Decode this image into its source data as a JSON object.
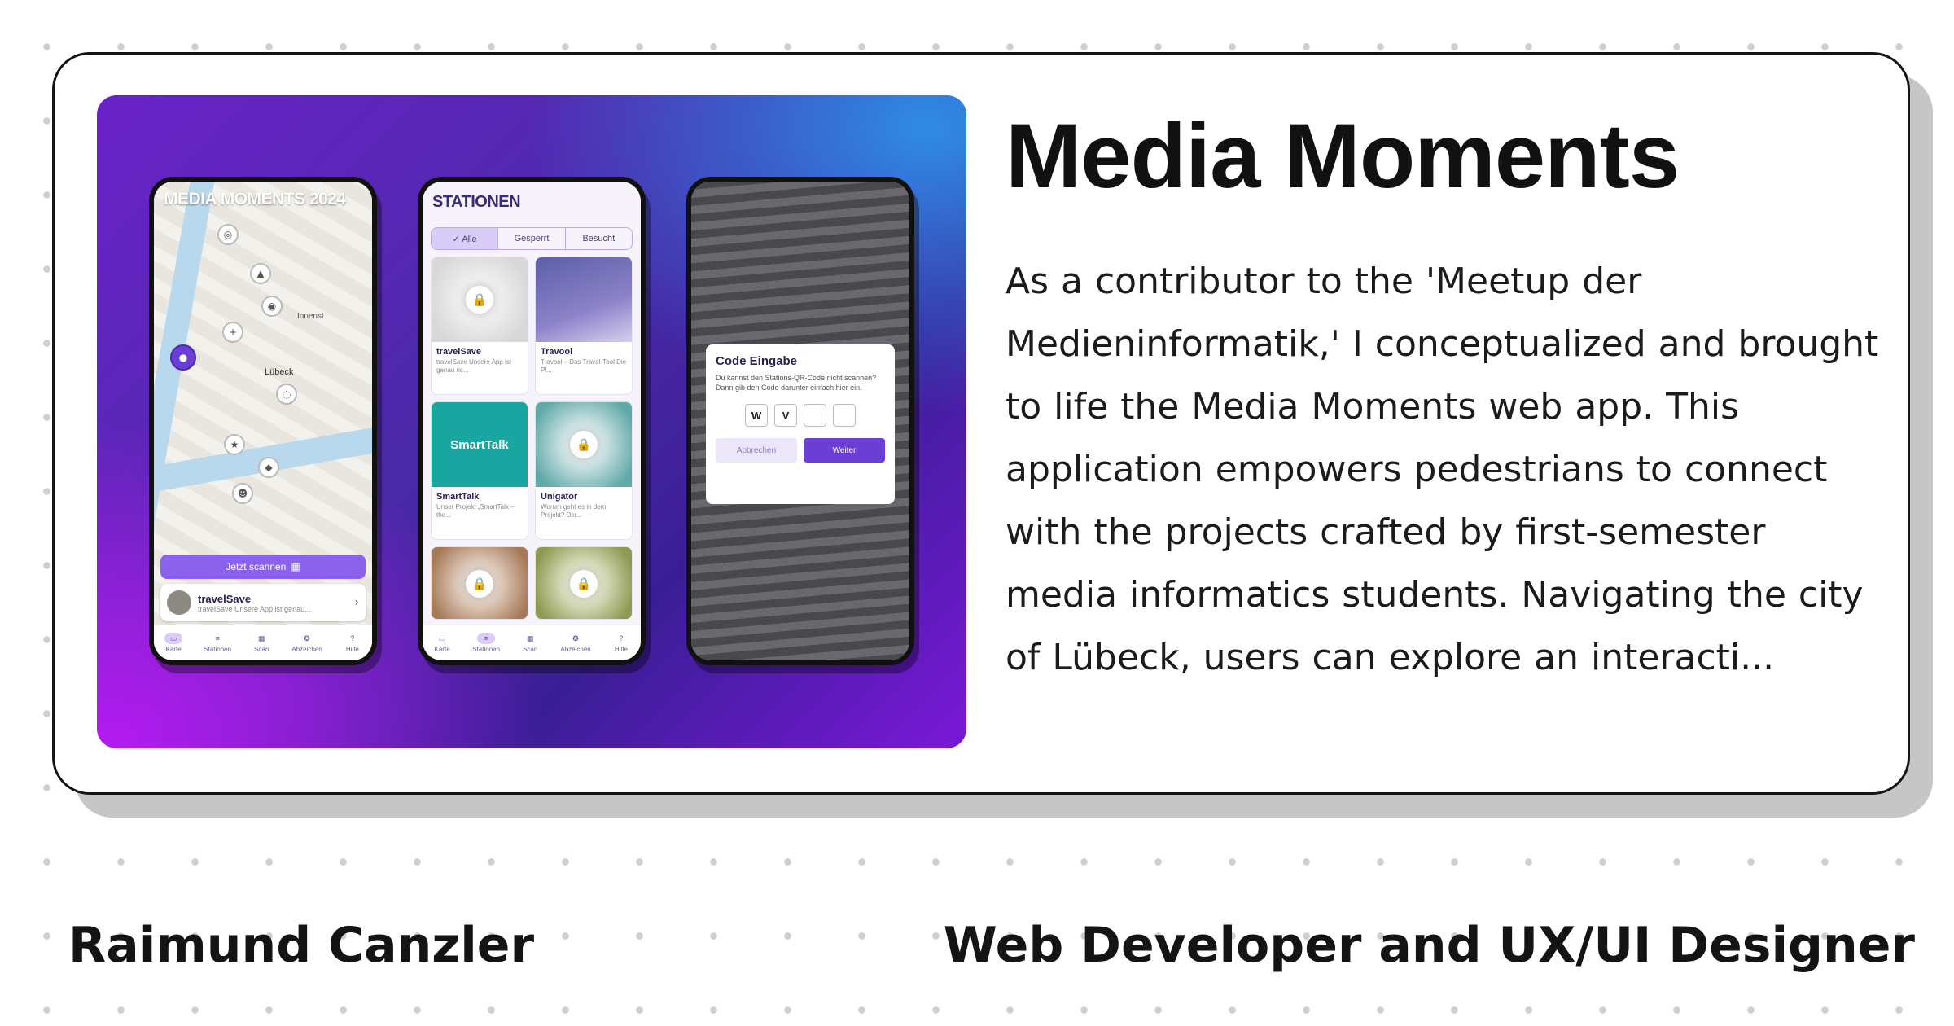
{
  "project": {
    "title": "Media Moments",
    "description": "As a contributor to the 'Meetup der Medieninformatik,' I conceptualized and brought to life the Media Moments web app. This application empowers pedestrians to connect with the projects crafted by first-semester media informatics students. Navigating the city of Lübeck, users can explore an interacti..."
  },
  "author": {
    "name": "Raimund Canzler",
    "role": "Web Developer and UX/UI Designer"
  },
  "mockup": {
    "map_screen": {
      "title": "MEDIA MOMENTS 2024",
      "city_label": "Lübeck",
      "area_label": "Innenst",
      "scan_button": "Jetzt scannen",
      "popup_title": "travelSave",
      "popup_text": "travelSave Unsere App ist genau...",
      "tabs": [
        "Karte",
        "Stationen",
        "Scan",
        "Abzeichen",
        "Hilfe"
      ]
    },
    "stations_screen": {
      "title": "STATIONEN",
      "filters": [
        "✓ Alle",
        "Gesperrt",
        "Besucht"
      ],
      "tiles": [
        {
          "name": "travelSave",
          "desc": "travelSave Unsere App ist genau ric..."
        },
        {
          "name": "Travool",
          "desc": "Travool – Das Travel-Tool Die Pl..."
        },
        {
          "name": "SmartTalk",
          "desc": "Unser Projekt „SmartTalk – the..."
        },
        {
          "name": "Unigator",
          "desc": "Worum geht es in dem Projekt? Der..."
        }
      ],
      "tile_image_text": "SmartTalk",
      "tabs": [
        "Karte",
        "Stationen",
        "Scan",
        "Abzeichen",
        "Hilfe"
      ]
    },
    "code_screen": {
      "dialog_title": "Code Eingabe",
      "dialog_text": "Du kannst den Stations-QR-Code nicht scannen? Dann gib den Code darunter einfach hier ein.",
      "code_chars": [
        "W",
        "V",
        "",
        ""
      ],
      "cancel_label": "Abbrechen",
      "next_label": "Weiter"
    }
  },
  "colors": {
    "accent": "#6b3fd6",
    "border": "#141414",
    "shadow": "#c6c6c6"
  }
}
